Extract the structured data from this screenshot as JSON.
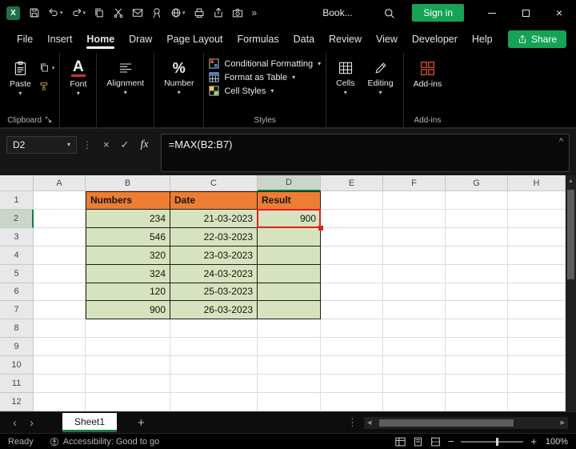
{
  "colors": {
    "accent_green": "#15A356",
    "excel_green": "#107C41",
    "table_header_fill": "#ED7D31",
    "table_data_fill": "#D7E3BE",
    "highlight_red": "#E0201C"
  },
  "icons": {
    "caret_down": "▾",
    "chevron_up": "^",
    "kebab": "⋮",
    "cancel": "×",
    "enter": "✓",
    "fx": "fx",
    "overflow": "»",
    "close": "×",
    "scroll_up": "▲",
    "scroll_left": "◀",
    "scroll_right": "▶",
    "nav_left": "‹",
    "nav_right": "›",
    "add_sheet": "+",
    "zoom_out": "−",
    "zoom_in": "+",
    "percent": "%",
    "font_letter": "A",
    "app_letter": "X"
  },
  "titlebar": {
    "document_name": "Book...",
    "sign_in_label": "Sign in"
  },
  "menubar": {
    "items": [
      "File",
      "Insert",
      "Home",
      "Draw",
      "Page Layout",
      "Formulas",
      "Data",
      "Review",
      "View",
      "Developer",
      "Help"
    ],
    "active_item": "Home",
    "share_label": "Share"
  },
  "ribbon": {
    "paste_label": "Paste",
    "font_label": "Font",
    "alignment_label": "Alignment",
    "number_label": "Number",
    "conditional_formatting_label": "Conditional Formatting",
    "format_as_table_label": "Format as Table",
    "cell_styles_label": "Cell Styles",
    "cells_label": "Cells",
    "editing_label": "Editing",
    "addins_label": "Add-ins",
    "group_labels": {
      "clipboard": "Clipboard",
      "styles": "Styles",
      "addins": "Add-ins"
    }
  },
  "formula_bar": {
    "name_box_value": "D2",
    "formula": "=MAX(B2:B7)"
  },
  "sheet": {
    "columns": [
      "A",
      "B",
      "C",
      "D",
      "E",
      "F",
      "G",
      "H"
    ],
    "row_count": 12,
    "active_cell": "D2",
    "active_col": "D",
    "active_row": 2,
    "cells": {
      "B1": "Numbers",
      "C1": "Date",
      "D1": "Result",
      "B2": "234",
      "C2": "21-03-2023",
      "D2": "900",
      "B3": "546",
      "C3": "22-03-2023",
      "B4": "320",
      "C4": "23-03-2023",
      "B5": "324",
      "C5": "24-03-2023",
      "B6": "120",
      "C6": "25-03-2023",
      "B7": "900",
      "C7": "26-03-2023"
    }
  },
  "sheet_tabs": {
    "tabs": [
      "Sheet1"
    ],
    "active_tab": "Sheet1"
  },
  "status_bar": {
    "mode": "Ready",
    "accessibility": "Accessibility: Good to go",
    "zoom_level": "100%"
  }
}
